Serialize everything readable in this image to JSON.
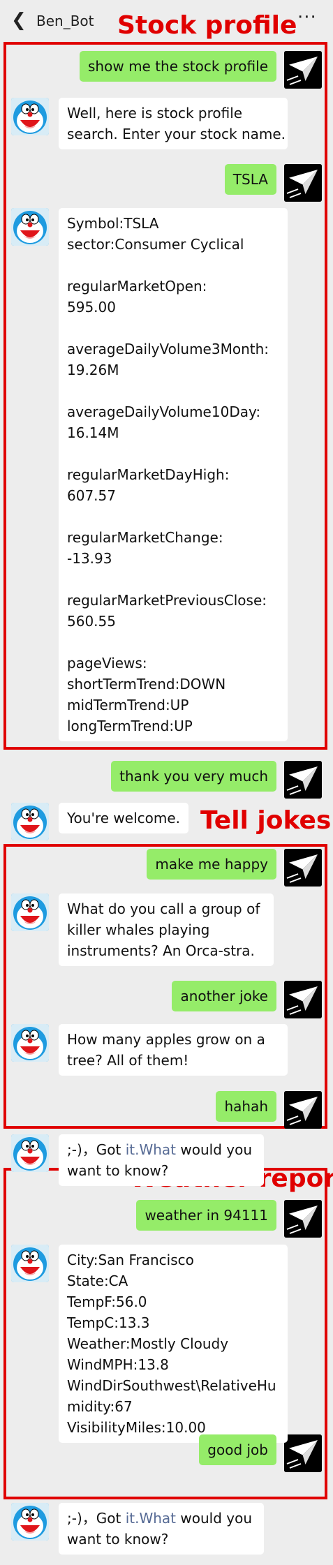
{
  "header": {
    "back_icon": "chevron-left-icon",
    "title": "Ben_Bot",
    "more_icon": "more-dots-icon",
    "more_glyph": "···"
  },
  "annotations": {
    "stock_profile": "Stock profile",
    "tell_jokes": "Tell jokes",
    "weather_report": "Weather report",
    "frame_color": "#e00000"
  },
  "colors": {
    "outgoing_bubble": "#95ec69",
    "incoming_bubble": "#ffffff",
    "background": "#ededed",
    "link": "#576b95"
  },
  "messages": [
    {
      "sender": "user",
      "lines": [
        "show me the stock profile"
      ]
    },
    {
      "sender": "bot",
      "lines": [
        "Well, here is stock profile",
        "search. Enter your stock name."
      ]
    },
    {
      "sender": "user",
      "lines": [
        "TSLA"
      ]
    },
    {
      "sender": "bot",
      "lines": [
        "Symbol:TSLA",
        "sector:Consumer Cyclical",
        "",
        "regularMarketOpen:",
        "595.00",
        "",
        "averageDailyVolume3Month:",
        "19.26M",
        "",
        "averageDailyVolume10Day:",
        "16.14M",
        "",
        "regularMarketDayHigh:",
        "607.57",
        "",
        "regularMarketChange:",
        "-13.93",
        "",
        "regularMarketPreviousClose:",
        "560.55",
        "",
        "pageViews:",
        "shortTermTrend:DOWN",
        "midTermTrend:UP",
        "longTermTrend:UP"
      ]
    },
    {
      "sender": "user",
      "lines": [
        "thank you very much"
      ]
    },
    {
      "sender": "bot",
      "lines": [
        "You're welcome."
      ]
    },
    {
      "sender": "user",
      "lines": [
        "make me happy"
      ]
    },
    {
      "sender": "bot",
      "lines": [
        "What do you call a group of",
        "killer whales playing",
        "instruments? An Orca-stra."
      ]
    },
    {
      "sender": "user",
      "lines": [
        "another joke"
      ]
    },
    {
      "sender": "bot",
      "lines": [
        "How many apples grow on a",
        "tree? All of them!"
      ]
    },
    {
      "sender": "user",
      "lines": [
        "hahah"
      ]
    },
    {
      "sender": "bot",
      "lines": [
        ";-)，Got ",
        "would you",
        "want to know?"
      ],
      "link": "it.What"
    },
    {
      "sender": "user",
      "lines": [
        "weather in 94111"
      ]
    },
    {
      "sender": "bot",
      "lines": [
        "City:San Francisco",
        "State:CA",
        "TempF:56.0",
        "TempC:13.3",
        "Weather:Mostly Cloudy",
        "WindMPH:13.8",
        "WindDirSouthwest\\RelativeHu",
        "midity:67",
        "VisibilityMiles:10.00"
      ]
    },
    {
      "sender": "user",
      "lines": [
        "good job"
      ]
    },
    {
      "sender": "bot",
      "lines": [
        ";-)，Got ",
        "would you",
        "want to know?"
      ],
      "link": "it.What"
    }
  ],
  "avatars": {
    "user": "paper-plane-avatar-icon",
    "bot": "doraemon-avatar-icon"
  }
}
